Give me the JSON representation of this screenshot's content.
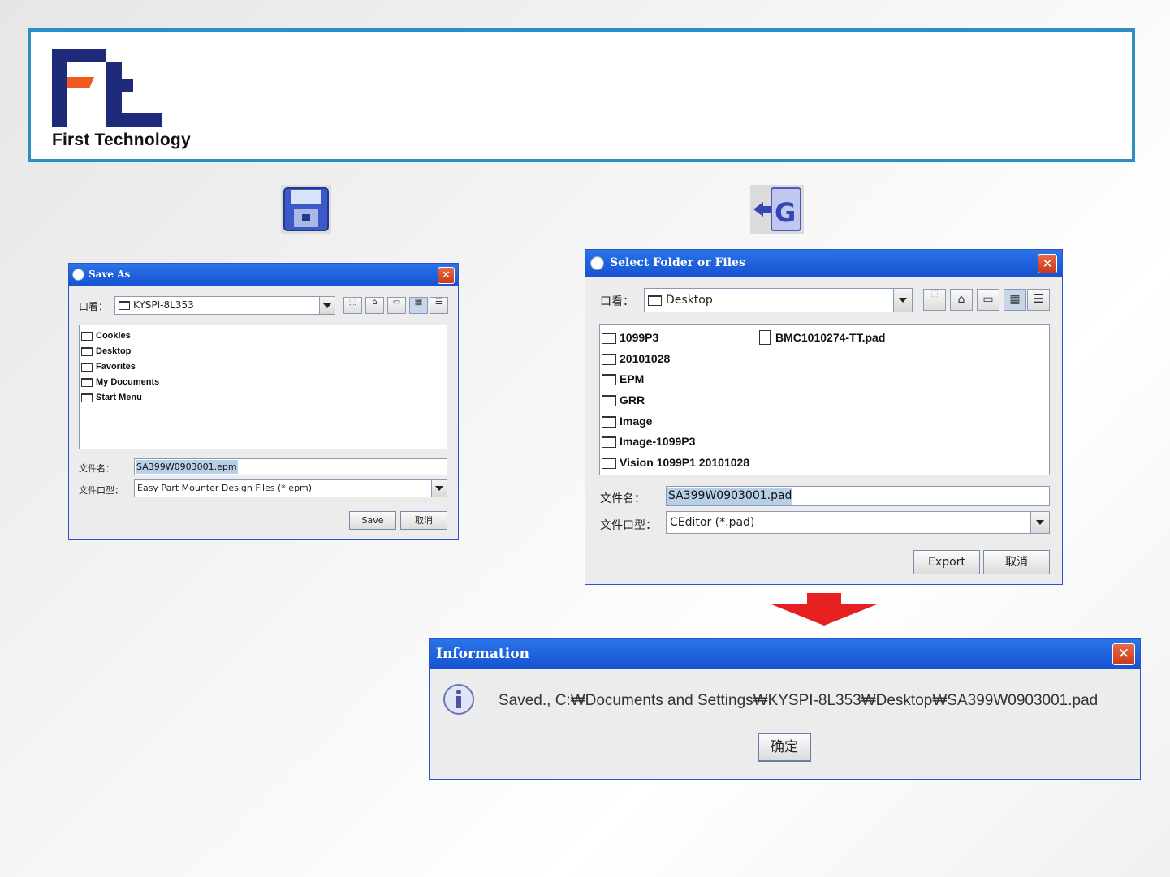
{
  "header": {
    "logo_text": "First Technology",
    "brand_colors": {
      "navy": "#1f2a7a",
      "orange": "#f05a1e",
      "frame": "#2b8fc4"
    }
  },
  "toolbar_icons": {
    "save": "floppy-disk-icon",
    "export": "export-g-icon"
  },
  "save_dialog": {
    "title": "Save As",
    "look_in_label": "口看：",
    "look_in_value": "KYSPI-8L353",
    "folders": [
      "Cookies",
      "Desktop",
      "Favorites",
      "My Documents",
      "Start Menu"
    ],
    "filename_label": "文件名：",
    "filename_value": "SA399W0903001.epm",
    "filetype_label": "文件口型：",
    "filetype_value": "Easy Part Mounter Design Files (*.epm)",
    "save_button": "Save",
    "cancel_button": "取消"
  },
  "select_dialog": {
    "title": "Select Folder or Files",
    "look_in_label": "口看：",
    "look_in_value": "Desktop",
    "folders": [
      "1099P3",
      "20101028",
      "EPM",
      "GRR",
      "Image",
      "Image-1099P3",
      "Vision 1099P1  20101028"
    ],
    "files": [
      "BMC1010274-TT.pad"
    ],
    "filename_label": "文件名：",
    "filename_value": "SA399W0903001.pad",
    "filetype_label": "文件口型：",
    "filetype_value": "CEditor (*.pad)",
    "export_button": "Export",
    "cancel_button": "取消"
  },
  "info_dialog": {
    "title": "Information",
    "message": "Saved., C:₩Documents and Settings₩KYSPI-8L353₩Desktop₩SA399W0903001.pad",
    "ok_button": "确定"
  }
}
